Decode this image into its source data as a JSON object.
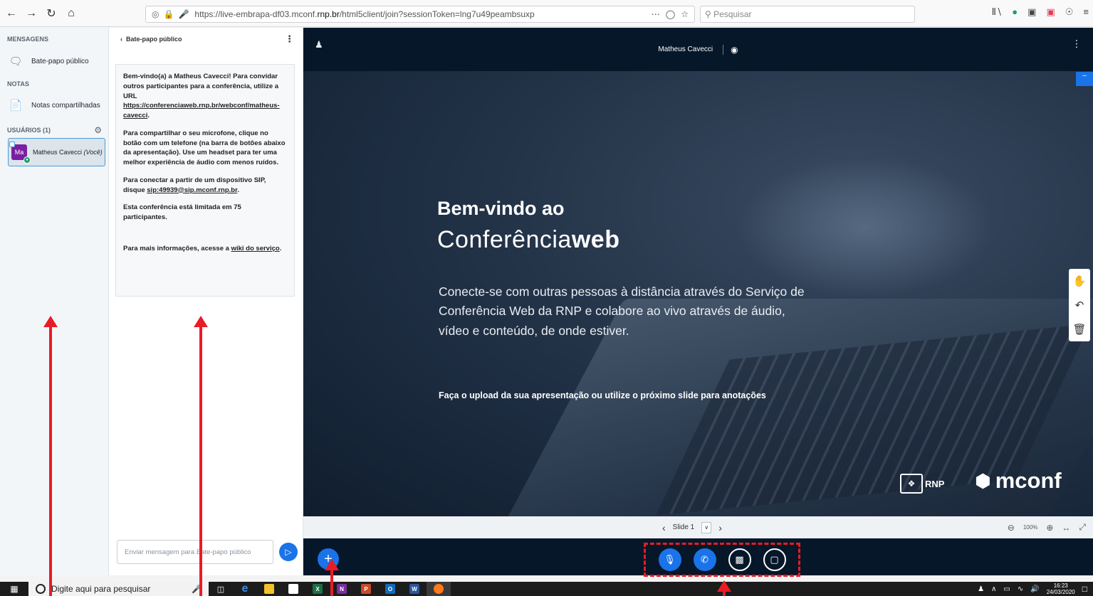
{
  "browser": {
    "url": "https://live-embrapa-df03.mconf.rnp.br/html5client/join?sessionToken=lng7u49peambsuxp",
    "url_prefix": "https://live-embrapa-df03.mconf.",
    "url_domain": "rnp.br",
    "url_suffix": "/html5client/join?sessionToken=lng7u49peambsuxp",
    "search_placeholder": "Pesquisar"
  },
  "left_panel": {
    "messages_title": "MENSAGENS",
    "public_chat": "Bate-papo público",
    "notes_title": "NOTAS",
    "shared_notes": "Notas compartilhadas",
    "users_title": "USUÁRIOS (1)",
    "user": {
      "initials": "Ma",
      "name": "Matheus Cavecci",
      "you_label": "(Você)"
    }
  },
  "chat": {
    "header": "Bate-papo público",
    "welcome_1_pre": "Bem-vindo(a) a ",
    "welcome_1_name": "Matheus Cavecci",
    "welcome_1_post": "! Para convidar outros participantes para a conferência, utilize a URL ",
    "welcome_1_link": "https://conferenciaweb.rnp.br/webconf/matheus-cavecci",
    "welcome_2": "Para compartilhar o seu microfone, clique no botão com um telefone (na barra de botões abaixo da apresentação). Use um headset para ter uma melhor experiência de áudio com menos ruídos.",
    "welcome_3_pre": "Para conectar a partir de um dispositivo SIP, disque ",
    "welcome_3_link": "sip:49939@sip.mconf.rnp.br",
    "welcome_4": "Esta conferência está limitada em 75 participantes.",
    "welcome_5_pre": "Para mais informações, acesse a ",
    "welcome_5_link": "wiki do serviço",
    "input_placeholder": "Enviar mensagem para Bate-papo público"
  },
  "main": {
    "presenter_name": "Matheus Cavecci",
    "slide": {
      "heading_1": "Bem-vindo ao",
      "heading_2_light": "Conferência",
      "heading_2_bold": "web",
      "description": "Conecte-se com outras pessoas à distância através do Serviço de Conferência Web da RNP e colabore ao vivo através de áudio, vídeo e conteúdo, de onde estiver.",
      "upload_hint": "Faça o upload da sua apresentação ou utilize o próximo slide para anotações",
      "logo_rnp": "RNP",
      "logo_mconf": "mconf"
    },
    "slide_nav": {
      "current": "Slide 1",
      "zoom": "100%"
    }
  },
  "taskbar": {
    "search_placeholder": "Digite aqui para pesquisar",
    "time": "16:23",
    "date": "24/03/2020"
  },
  "colors": {
    "accent": "#1a73e8",
    "annotation": "#e81c24",
    "dark_bg": "#06172a"
  }
}
